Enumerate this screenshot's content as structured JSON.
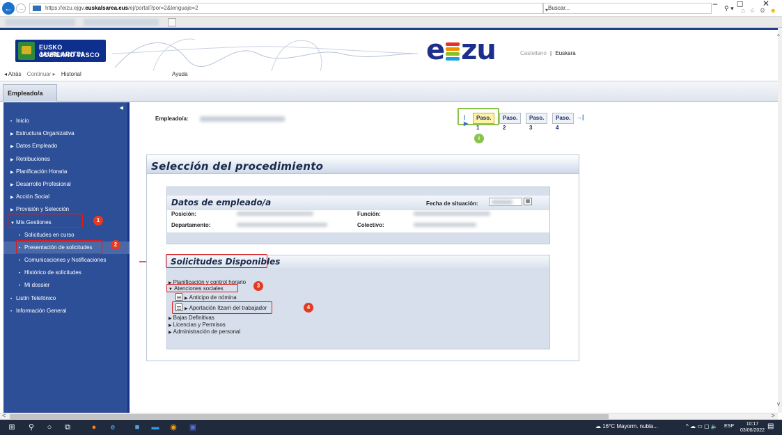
{
  "browser": {
    "url_prefix": "https://eizu.ejgv.",
    "url_domain": "euskalsarea.eus",
    "url_path": "/ej/portal?por=2&lenguaje=2",
    "search_placeholder": "Buscar...",
    "back_icon": "arrow-left-icon",
    "window_controls": "–  ◻  ✕"
  },
  "header": {
    "logo_line1": "EUSKO JAURLARITZA",
    "logo_line2": "GOBIERNO VASCO",
    "app_logo_left": "e",
    "app_logo_right": "zu",
    "lang_castellano": "Castellano",
    "lang_separator": "|",
    "lang_euskara": "Euskara",
    "nav_back": "◂ Atrás",
    "nav_forward": "Continuar ▸",
    "nav_history": "Historial",
    "help": "Ayuda",
    "logo_bar_colors": [
      "#e6332a",
      "#f29100",
      "#8cbf26",
      "#1aa1d8"
    ]
  },
  "profile_tab": "Empleado/a",
  "sidebar": {
    "items": [
      {
        "label": "Inicio",
        "marker": "•"
      },
      {
        "label": "Estructura Organizativa",
        "marker": "▶"
      },
      {
        "label": "Datos Empleado",
        "marker": "▶"
      },
      {
        "label": "Retribuciones",
        "marker": "▶"
      },
      {
        "label": "Planificación Horaria",
        "marker": "▶"
      },
      {
        "label": "Desarrollo Profesional",
        "marker": "▶"
      },
      {
        "label": "Acción Social",
        "marker": "▶"
      },
      {
        "label": "Provisión y Selección",
        "marker": "▶"
      },
      {
        "label": "Mis Gestiones",
        "marker": "▼"
      },
      {
        "label": "Solicitudes en curso",
        "marker": "•"
      },
      {
        "label": "Presentación de solicitudes",
        "marker": "•"
      },
      {
        "label": "Comunicaciones y Notificaciones",
        "marker": "•"
      },
      {
        "label": "Histórico de solicitudes",
        "marker": "•"
      },
      {
        "label": "Mi dossier",
        "marker": "•"
      },
      {
        "label": "Listín Telefónico",
        "marker": "•"
      },
      {
        "label": "Información General",
        "marker": "•"
      }
    ]
  },
  "badges": {
    "b1": "1",
    "b2": "2",
    "b3": "3",
    "b4": "4",
    "info": "i"
  },
  "main": {
    "employee_label": "Empleado/a:",
    "steps": [
      "Paso. 1",
      "Paso. 2",
      "Paso. 3",
      "Paso. 4"
    ],
    "procedure_title": "Selección del procedimiento",
    "employee_data_title": "Datos de empleado/a",
    "fecha_label": "Fecha de situación:",
    "posicion_label": "Posición:",
    "funcion_label": "Función:",
    "departamento_label": "Departamento:",
    "colectivo_label": "Colectivo:",
    "available_title": "Solicitudes Disponibles",
    "tree": [
      {
        "label": "Planificación y control horario",
        "marker": "▶"
      },
      {
        "label": "Atenciones sociales",
        "marker": "▼"
      },
      {
        "label": "Anticipo de nómina",
        "marker": "▶"
      },
      {
        "label": "Aportación Itzarri del trabajador",
        "marker": "▶"
      },
      {
        "label": "Bajas Definitivas",
        "marker": "▶"
      },
      {
        "label": "Licencias y Permisos",
        "marker": "▶"
      },
      {
        "label": "Administración de personal",
        "marker": "▶"
      }
    ]
  },
  "taskbar": {
    "weather": "16°C  Mayorm. nubla...",
    "lang": "ESP",
    "time": "10:17",
    "date": "03/06/2022"
  }
}
